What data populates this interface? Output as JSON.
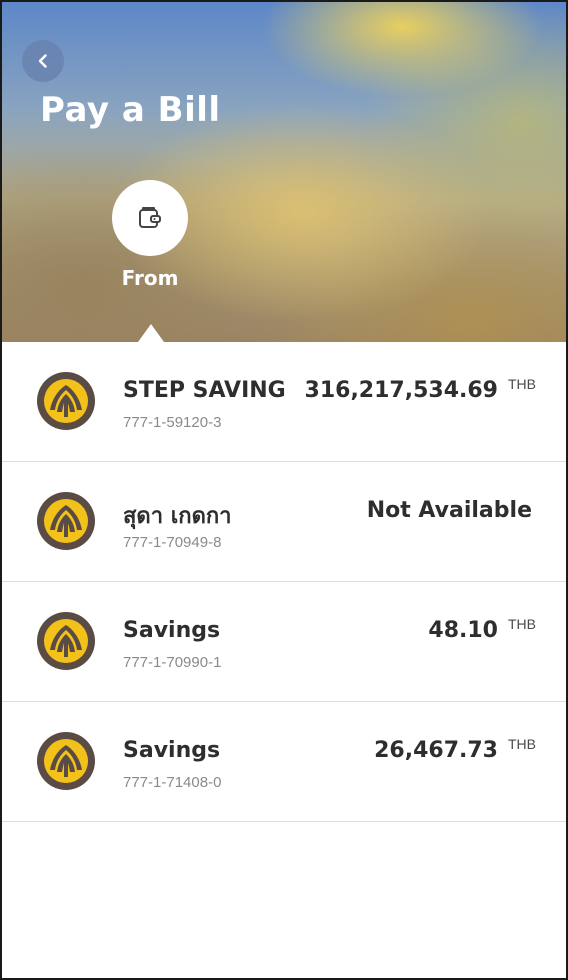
{
  "header": {
    "title": "Pay a Bill",
    "back_icon": "chevron-left-icon",
    "step": {
      "label": "From",
      "icon": "wallet-icon"
    }
  },
  "accounts": [
    {
      "name": "STEP SAVING",
      "number": "777-1-59120-3",
      "amount": "316,217,534.69",
      "currency": "THB",
      "status": ""
    },
    {
      "name": "สุดา เกดกา",
      "number": "777-1-70949-8",
      "amount": "",
      "currency": "",
      "status": "Not Available"
    },
    {
      "name": "Savings",
      "number": "777-1-70990-1",
      "amount": "48.10",
      "currency": "THB",
      "status": ""
    },
    {
      "name": "Savings",
      "number": "777-1-71408-0",
      "amount": "26,467.73",
      "currency": "THB",
      "status": ""
    }
  ],
  "colors": {
    "logo_outer": "#5a4b45",
    "logo_inner": "#f2c21b",
    "text_dark": "#2e2e2e",
    "text_muted": "#8a8a8a"
  }
}
